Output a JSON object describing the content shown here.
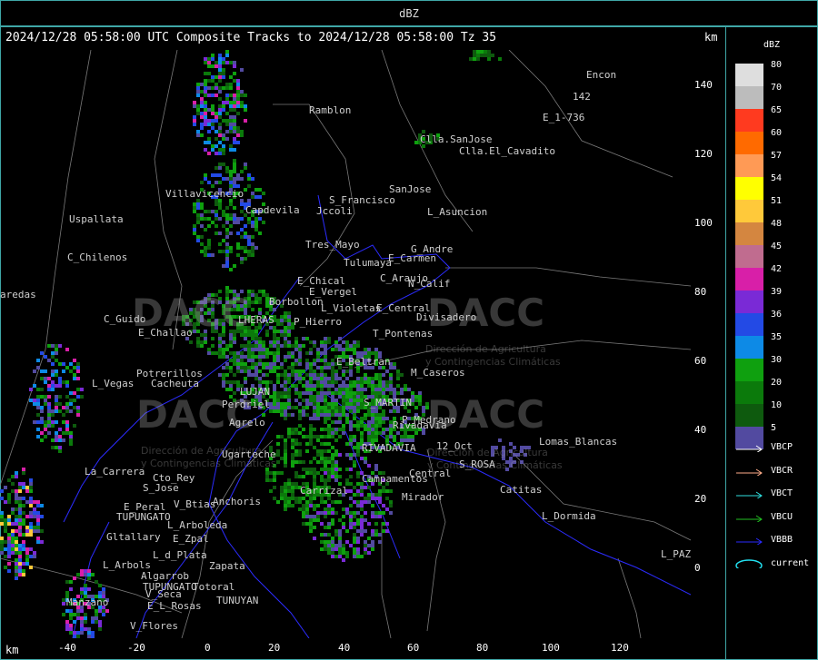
{
  "top_title": "dBZ",
  "header": "2024/12/28 05:58:00 UTC Composite Tracks to 2024/12/28 05:58:00 Tz 35",
  "km_unit": "km",
  "y_ticks": [
    "140",
    "120",
    "100",
    "80",
    "60",
    "40",
    "20",
    "0"
  ],
  "x_ticks": [
    "-40",
    "-20",
    "0",
    "20",
    "40",
    "60",
    "80",
    "100",
    "120"
  ],
  "places": [
    {
      "name": "Ramblon"
    },
    {
      "name": "Encon"
    },
    {
      "name": "142"
    },
    {
      "name": "E_1-736"
    },
    {
      "name": "Clla.SanJose"
    },
    {
      "name": "Clla.El_Cavadito"
    },
    {
      "name": "S_Francisco"
    },
    {
      "name": "SanJose"
    },
    {
      "name": "Villavicencio"
    },
    {
      "name": "Uspallata"
    },
    {
      "name": "Capdevila"
    },
    {
      "name": "Jccoli"
    },
    {
      "name": "L_Asuncion"
    },
    {
      "name": "Tres_Mayo"
    },
    {
      "name": "G_Andre"
    },
    {
      "name": "Tulumaya"
    },
    {
      "name": "E_Carmen"
    },
    {
      "name": "C_Chilenos"
    },
    {
      "name": "C_Araujo"
    },
    {
      "name": "E_Chical"
    },
    {
      "name": "N_Calif"
    },
    {
      "name": "E_Vergel"
    },
    {
      "name": "Borbollon"
    },
    {
      "name": "L_Violetas"
    },
    {
      "name": "E_Central"
    },
    {
      "name": "Divisadero"
    },
    {
      "name": "C_Guido"
    },
    {
      "name": "LHERAS"
    },
    {
      "name": "P_Hierro"
    },
    {
      "name": "E_Challao"
    },
    {
      "name": "T_Pontenas"
    },
    {
      "name": "Potrerillos"
    },
    {
      "name": "E_Beltran"
    },
    {
      "name": "M_Caseros"
    },
    {
      "name": "L_Vegas"
    },
    {
      "name": "Cacheuta"
    },
    {
      "name": "LUJAN"
    },
    {
      "name": "Perdriel"
    },
    {
      "name": "S_MARTIN"
    },
    {
      "name": "Agrelo"
    },
    {
      "name": "P_Medrano"
    },
    {
      "name": "Rivadavia"
    },
    {
      "name": "Lomas_Blancas"
    },
    {
      "name": "Ugarteche"
    },
    {
      "name": "12_Oct"
    },
    {
      "name": "RIVADAVIA"
    },
    {
      "name": "S_ROSA"
    },
    {
      "name": "La_Carrera"
    },
    {
      "name": "Cto_Rey"
    },
    {
      "name": "Central"
    },
    {
      "name": "Campamentos"
    },
    {
      "name": "S_Jose"
    },
    {
      "name": "Catitas"
    },
    {
      "name": "Anchoris"
    },
    {
      "name": "Carrizal"
    },
    {
      "name": "Mirador"
    },
    {
      "name": "E_Peral"
    },
    {
      "name": "V_Btias"
    },
    {
      "name": "TUPUNGATO"
    },
    {
      "name": "L_Dormida"
    },
    {
      "name": "L_Arboleda"
    },
    {
      "name": "Gltallary"
    },
    {
      "name": "E_Zpal"
    },
    {
      "name": "L_d_Plata"
    },
    {
      "name": "L_PAZ"
    },
    {
      "name": "L_Arbols"
    },
    {
      "name": "Zapata"
    },
    {
      "name": "Algarrob"
    },
    {
      "name": "TUPUNGATO"
    },
    {
      "name": "Totoral"
    },
    {
      "name": "V_Seca"
    },
    {
      "name": "Manzano"
    },
    {
      "name": "E_L_Rosas"
    },
    {
      "name": "TUNUYAN"
    },
    {
      "name": "V_Flores"
    },
    {
      "name": "aredas"
    }
  ],
  "watermark": {
    "logo_text": "DACC",
    "subtitle_1": "Dirección de Agricultura",
    "subtitle_2": "y Contingencias Climáticas"
  },
  "legend": {
    "title": "dBZ",
    "entries": [
      {
        "label": "80",
        "color": "#dedede"
      },
      {
        "label": "70",
        "color": "#bcbcbc"
      },
      {
        "label": "65",
        "color": "#ff3a1f"
      },
      {
        "label": "60",
        "color": "#ff6a00"
      },
      {
        "label": "57",
        "color": "#ff9a55"
      },
      {
        "label": "54",
        "color": "#ffff00"
      },
      {
        "label": "51",
        "color": "#ffc93a"
      },
      {
        "label": "48",
        "color": "#d48640"
      },
      {
        "label": "45",
        "color": "#c06c8f"
      },
      {
        "label": "42",
        "color": "#d81fa8"
      },
      {
        "label": "39",
        "color": "#7a2ad6"
      },
      {
        "label": "36",
        "color": "#234ae5"
      },
      {
        "label": "35",
        "color": "#0d8ae6"
      },
      {
        "label": "30",
        "color": "#0fa00f"
      },
      {
        "label": "20",
        "color": "#0b7a0b"
      },
      {
        "label": "10",
        "color": "#0e5a0e"
      },
      {
        "label": "5",
        "color": "#524aa0"
      }
    ]
  },
  "tracks": [
    {
      "label": "VBCP",
      "color": "#ffffff"
    },
    {
      "label": "VBCR",
      "color": "#ffad8a"
    },
    {
      "label": "VBCT",
      "color": "#2fe0e0"
    },
    {
      "label": "VBCU",
      "color": "#22c022"
    },
    {
      "label": "VBBB",
      "color": "#2a2aff"
    },
    {
      "label": "current",
      "color": "#22e0f0"
    }
  ]
}
